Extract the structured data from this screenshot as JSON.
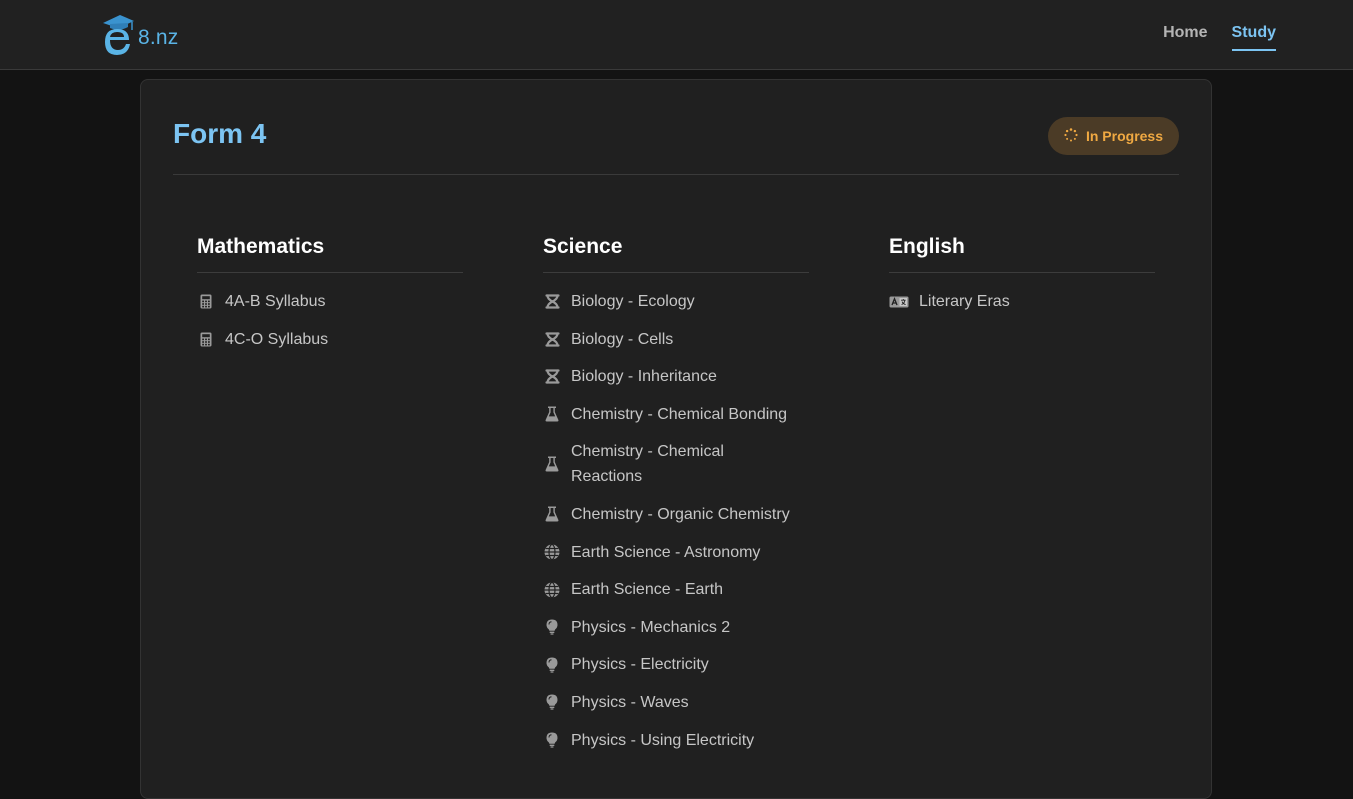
{
  "nav": {
    "logo_text": "8.nz",
    "links": [
      {
        "label": "Home",
        "active": false
      },
      {
        "label": "Study",
        "active": true
      }
    ]
  },
  "page": {
    "title": "Form 4",
    "status": "In Progress"
  },
  "subjects": {
    "mathematics": {
      "heading": "Mathematics",
      "items": [
        {
          "label": "4A-B Syllabus",
          "icon": "calculator-icon"
        },
        {
          "label": "4C-O Syllabus",
          "icon": "calculator-icon"
        }
      ]
    },
    "science": {
      "heading": "Science",
      "items": [
        {
          "label": "Biology - Ecology",
          "icon": "dna-icon"
        },
        {
          "label": "Biology - Cells",
          "icon": "dna-icon"
        },
        {
          "label": "Biology - Inheritance",
          "icon": "dna-icon"
        },
        {
          "label": "Chemistry - Chemical Bonding",
          "icon": "flask-icon"
        },
        {
          "label": "Chemistry - Chemical Reactions",
          "icon": "flask-icon"
        },
        {
          "label": "Chemistry - Organic Chemistry",
          "icon": "flask-icon"
        },
        {
          "label": "Earth Science - Astronomy",
          "icon": "globe-icon"
        },
        {
          "label": "Earth Science - Earth",
          "icon": "globe-icon"
        },
        {
          "label": "Physics - Mechanics 2",
          "icon": "lightbulb-icon"
        },
        {
          "label": "Physics - Electricity",
          "icon": "lightbulb-icon"
        },
        {
          "label": "Physics - Waves",
          "icon": "lightbulb-icon"
        },
        {
          "label": "Physics - Using Electricity",
          "icon": "lightbulb-icon"
        }
      ]
    },
    "english": {
      "heading": "English",
      "items": [
        {
          "label": "Literary Eras",
          "icon": "language-icon"
        }
      ]
    }
  },
  "colors": {
    "accent": "#7cc4f2",
    "status_text": "#f0a942",
    "status_bg": "#4b3b26"
  }
}
